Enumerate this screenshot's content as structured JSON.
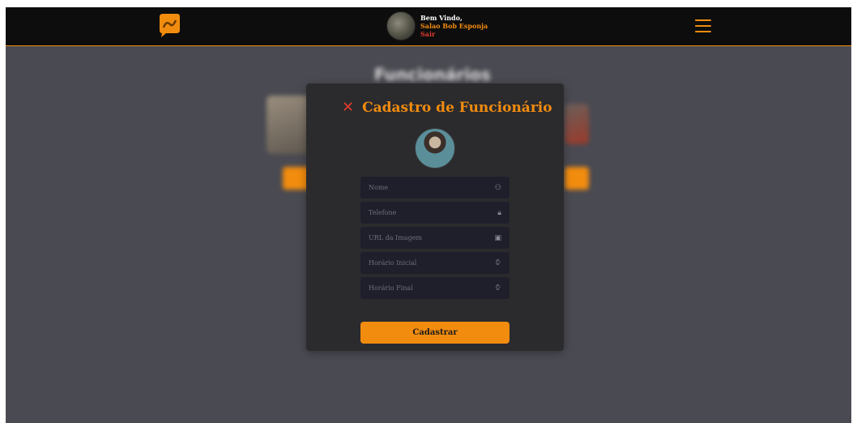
{
  "header": {
    "greeting": "Bem Vindo,",
    "salon_name": "Salao Bob Esponja",
    "logout_label": "Sair",
    "accent_color": "#f28c0f"
  },
  "background_page": {
    "title": "Funcionários"
  },
  "modal": {
    "title": "Cadastro de Funcionário",
    "close_symbol": "✕",
    "fields": [
      {
        "placeholder": "Nome",
        "icon": "user-icon",
        "glyph": "⚇"
      },
      {
        "placeholder": "Telefone",
        "icon": "lock-icon",
        "glyph": "🔒︎"
      },
      {
        "placeholder": "URL da Imagem",
        "icon": "image-icon",
        "glyph": "▣"
      },
      {
        "placeholder": "Horário Inicial",
        "icon": "watch-icon",
        "glyph": "⌚︎"
      },
      {
        "placeholder": "Horário Final",
        "icon": "watch-icon",
        "glyph": "⌚︎"
      }
    ],
    "submit_label": "Cadastrar"
  }
}
